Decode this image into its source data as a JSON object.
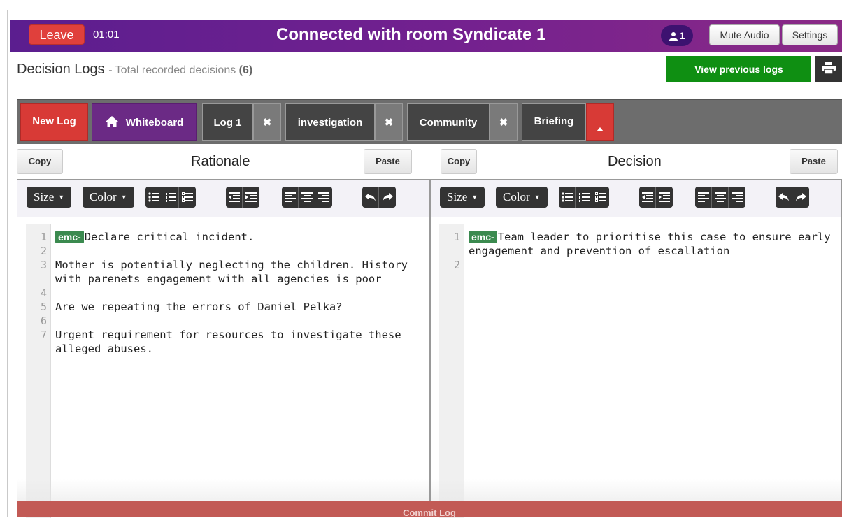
{
  "topbar": {
    "leave_label": "Leave",
    "timer": "01:01",
    "room_title": "Connected with room Syndicate 1",
    "user_count": "1",
    "mute_label": "Mute Audio",
    "settings_label": "Settings"
  },
  "logs_header": {
    "title": "Decision Logs",
    "subtitle_prefix": "- Total recorded decisions",
    "count": "(6)",
    "view_previous_label": "View previous logs"
  },
  "tabs": {
    "new_log": "New Log",
    "whiteboard": "Whiteboard",
    "items": [
      "Log 1",
      "investigation",
      "Community",
      "Briefing"
    ]
  },
  "panels": {
    "rationale": {
      "title": "Rationale",
      "copy_label": "Copy",
      "paste_label": "Paste",
      "lines": [
        {
          "n": "1",
          "tag": "emc-",
          "text": "Declare critical incident."
        },
        {
          "n": "2",
          "tag": "",
          "text": ""
        },
        {
          "n": "3",
          "tag": "",
          "text": "Mother is potentially neglecting the children. History with parenets engagement with all agencies is poor"
        },
        {
          "n": "4",
          "tag": "",
          "text": ""
        },
        {
          "n": "5",
          "tag": "",
          "text": "Are we repeating the errors of Daniel Pelka?"
        },
        {
          "n": "6",
          "tag": "",
          "text": ""
        },
        {
          "n": "7",
          "tag": "",
          "text": "Urgent requirement for resources to investigate these alleged abuses."
        }
      ]
    },
    "decision": {
      "title": "Decision",
      "copy_label": "Copy",
      "paste_label": "Paste",
      "lines": [
        {
          "n": "1",
          "tag": "emc-",
          "text": "Team leader to prioritise this case to ensure early engagement and prevention of escallation"
        },
        {
          "n": "2",
          "tag": "",
          "text": ""
        }
      ]
    }
  },
  "toolbar": {
    "size_label": "Size",
    "color_label": "Color"
  },
  "commit_label": "Commit Log",
  "colors": {
    "topbar": "#74218f",
    "leave": "#e0403c",
    "view_previous": "#0f8f12",
    "new_log": "#d83a36",
    "whiteboard": "#6b2a85",
    "emc_tag": "#3b8a4f",
    "commit": "#c25a55"
  },
  "icons": {
    "user": "user-icon",
    "print": "printer-icon",
    "home": "home-icon",
    "close": "close-icon",
    "collapse": "caret-up-icon"
  }
}
